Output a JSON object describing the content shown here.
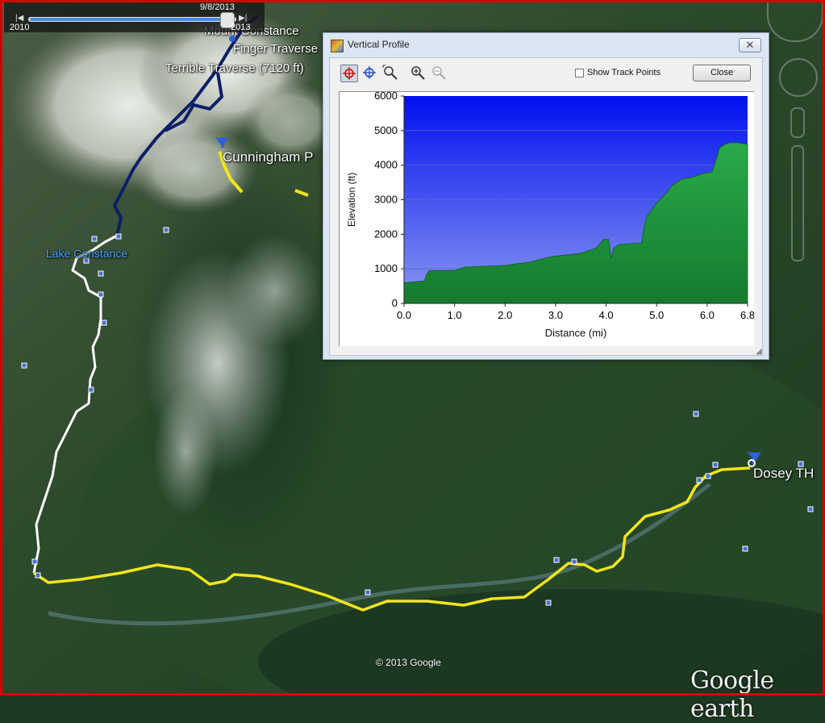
{
  "map": {
    "labels": {
      "mount_constance": "Mount Constance",
      "finger_traverse": "Finger Traverse",
      "terrible_traverse": "Terrible Traverse (7120 ft)",
      "cunningham": "Cunningham P",
      "lake_constance": "Lake Constance",
      "dosey_th": "Dosey TH"
    },
    "copyright": "© 2013 Google",
    "logo": "Google earth",
    "track_colors": {
      "yellow": "#f2e51c",
      "white": "#ffffff",
      "navy": "#0d1f66"
    }
  },
  "timeline": {
    "start_label": "2010",
    "end_label": "2013",
    "current_date": "9/8/2013",
    "position_fraction": 0.97
  },
  "profile_window": {
    "title": "Vertical Profile",
    "close_x": "✕",
    "tools": [
      "crosshair-red-icon",
      "crosshair-blue-icon",
      "zoom-region-icon",
      "zoom-in-icon",
      "zoom-out-icon"
    ],
    "show_track_points_label": "Show Track Points",
    "show_track_points_checked": false,
    "close_button_label": "Close"
  },
  "chart_data": {
    "type": "area",
    "title": "",
    "xlabel": "Distance   (mi)",
    "ylabel": "Elevation (ft)",
    "xlim": [
      0,
      6.8
    ],
    "ylim": [
      0,
      6000
    ],
    "x_ticks": [
      "0.0",
      "1.0",
      "2.0",
      "3.0",
      "4.0",
      "5.0",
      "6.0",
      "6.8"
    ],
    "y_ticks": [
      "0",
      "1000",
      "2000",
      "3000",
      "4000",
      "5000",
      "6000"
    ],
    "grid": true,
    "colors": {
      "fill": "#1e9a3c",
      "sky_top": "#0010f0",
      "sky_bottom": "#8a98f0"
    },
    "x": [
      0.0,
      0.4,
      0.45,
      0.5,
      1.0,
      1.2,
      2.0,
      2.5,
      2.9,
      3.2,
      3.5,
      3.8,
      3.95,
      4.05,
      4.1,
      4.15,
      4.25,
      4.7,
      4.75,
      4.8,
      5.0,
      5.2,
      5.3,
      5.5,
      5.7,
      5.9,
      6.1,
      6.25,
      6.35,
      6.45,
      6.6,
      6.8
    ],
    "y": [
      600,
      650,
      850,
      950,
      950,
      1050,
      1100,
      1200,
      1350,
      1400,
      1450,
      1600,
      1850,
      1850,
      1300,
      1600,
      1700,
      1750,
      2200,
      2500,
      2900,
      3200,
      3400,
      3600,
      3650,
      3750,
      3800,
      4500,
      4600,
      4650,
      4650,
      4600
    ]
  }
}
